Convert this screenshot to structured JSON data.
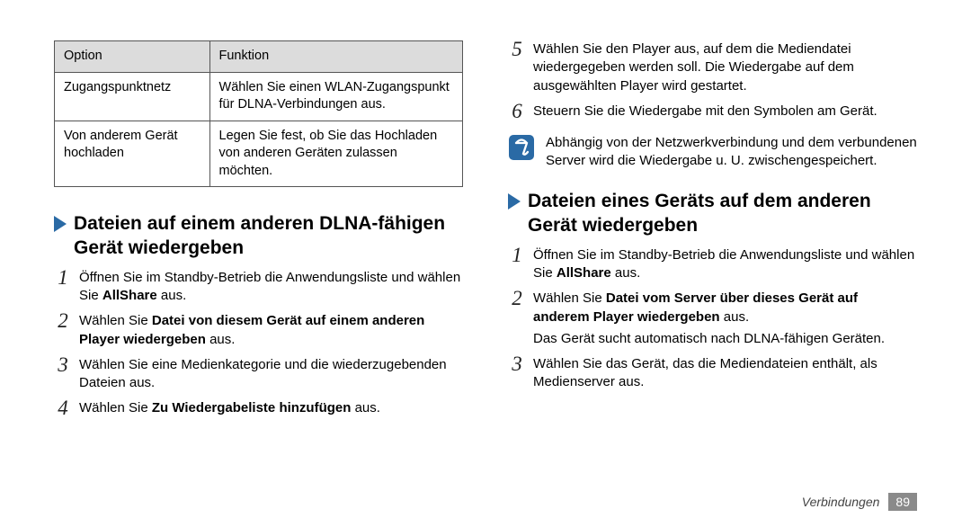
{
  "table": {
    "headers": {
      "option": "Option",
      "func": "Funktion"
    },
    "rows": [
      {
        "option": "Zugangspunktnetz",
        "func": "Wählen Sie einen WLAN-Zugangspunkt für DLNA-Verbindungen aus."
      },
      {
        "option": "Von anderem Gerät hochladen",
        "func": "Legen Sie fest, ob Sie das Hochladen von anderen Geräten zulassen möchten."
      }
    ]
  },
  "left": {
    "title": "Dateien auf einem anderen DLNA-fähigen Gerät wiedergeben",
    "steps": {
      "s1a": "Öffnen Sie im Standby-Betrieb die Anwendungsliste und wählen Sie ",
      "s1b": "AllShare",
      "s1c": " aus.",
      "s2a": "Wählen Sie ",
      "s2b": "Datei von diesem Gerät auf einem anderen Player wiedergeben",
      "s2c": " aus.",
      "s3": "Wählen Sie eine Medienkategorie und die wiederzugebenden Dateien aus.",
      "s4a": "Wählen Sie ",
      "s4b": "Zu Wiedergabeliste hinzufügen",
      "s4c": " aus."
    }
  },
  "right": {
    "steps": {
      "s5": "Wählen Sie den Player aus, auf dem die Mediendatei wiedergegeben werden soll. Die Wiedergabe auf dem ausgewählten Player wird gestartet.",
      "s6": "Steuern Sie die Wiedergabe mit den Symbolen am Gerät."
    },
    "note": "Abhängig von der Netzwerkverbindung und dem verbundenen Server wird die Wiedergabe u. U. zwischengespeichert.",
    "title": "Dateien eines Geräts auf dem anderen Gerät wiedergeben",
    "steps2": {
      "s1a": "Öffnen Sie im Standby-Betrieb die Anwendungsliste und wählen Sie ",
      "s1b": "AllShare",
      "s1c": " aus.",
      "s2a": "Wählen Sie ",
      "s2b": "Datei vom Server über dieses Gerät auf anderem Player wiedergeben",
      "s2c": " aus.",
      "s2d": "Das Gerät sucht automatisch nach DLNA-fähigen Geräten.",
      "s3": "Wählen Sie das Gerät, das die Mediendateien enthält, als Medienserver aus."
    }
  },
  "nums": {
    "n1": "1",
    "n2": "2",
    "n3": "3",
    "n4": "4",
    "n5": "5",
    "n6": "6"
  },
  "footer": {
    "label": "Verbindungen",
    "page": "89"
  }
}
